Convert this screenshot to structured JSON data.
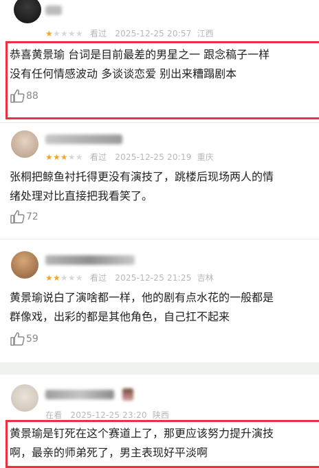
{
  "comments": [
    {
      "stars": 1,
      "label": "看过",
      "date": "2025-12-25 20:57",
      "location": "江西",
      "lines": [
        "恭喜黄景瑜 台词是目前最差的男星之一 跟念稿子一样",
        "没有任何情感波动  多谈谈恋爱 别出来糟蹋剧本"
      ],
      "likes": "88"
    },
    {
      "stars": 3,
      "label": "看过",
      "date": "2025-12-25 20:19",
      "location": "重庆",
      "lines": [
        "张桐把鲸鱼衬托得更没有演技了，跳楼后现场两人的情",
        "绪处理对比直接把我看笑了。"
      ],
      "likes": "72"
    },
    {
      "stars": 2,
      "label": "看过",
      "date": "2025-12-25 21:25",
      "location": "吉林",
      "lines": [
        "黄景瑜说白了演啥都一样，他的剧有点水花的一般都是",
        "群像戏，出彩的都是其他角色，自己扛不起来"
      ],
      "likes": "59"
    },
    {
      "stars": 0,
      "label": "在看",
      "date": "2025-12-25 23:20",
      "location": "陕西",
      "lines": [
        "黄景瑜是钉死在这个赛道上了，那更应该努力提升演技",
        "啊，最亲的师弟死了，男主表现好平淡啊"
      ],
      "likes": ""
    }
  ],
  "colors": {
    "accent_red": "#e8323f",
    "star": "#f5a623"
  }
}
